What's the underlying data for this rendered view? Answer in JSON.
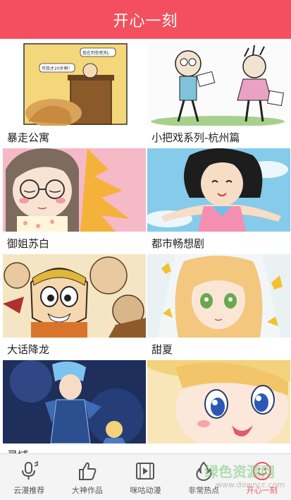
{
  "header": {
    "title": "开心一刻"
  },
  "comics": [
    {
      "title": "暴走公寓",
      "bubble_1": "现在判你死刑。",
      "bubble_2": "可我才20岁啊！"
    },
    {
      "title": "小把戏系列-杭州篇"
    },
    {
      "title": "御姐苏白"
    },
    {
      "title": "都市畅想剧"
    },
    {
      "title": "大话降龙"
    },
    {
      "title": "甜夏"
    },
    {
      "title": "灵域"
    },
    {
      "title": ""
    }
  ],
  "tabbar": {
    "items": [
      {
        "label": "云漫推荐",
        "icon": "microphone-icon"
      },
      {
        "label": "大神作品",
        "icon": "thumbs-up-icon"
      },
      {
        "label": "咪咕动漫",
        "icon": "film-play-icon"
      },
      {
        "label": "非常热点",
        "icon": "flame-icon"
      },
      {
        "label": "开心一刻",
        "icon": "smile-icon"
      }
    ]
  },
  "watermark": {
    "main": "绿色资源网",
    "sub": "www.downcc.com"
  },
  "colors": {
    "accent": "#f34f5e",
    "tab_bg": "#f4f4f4"
  }
}
